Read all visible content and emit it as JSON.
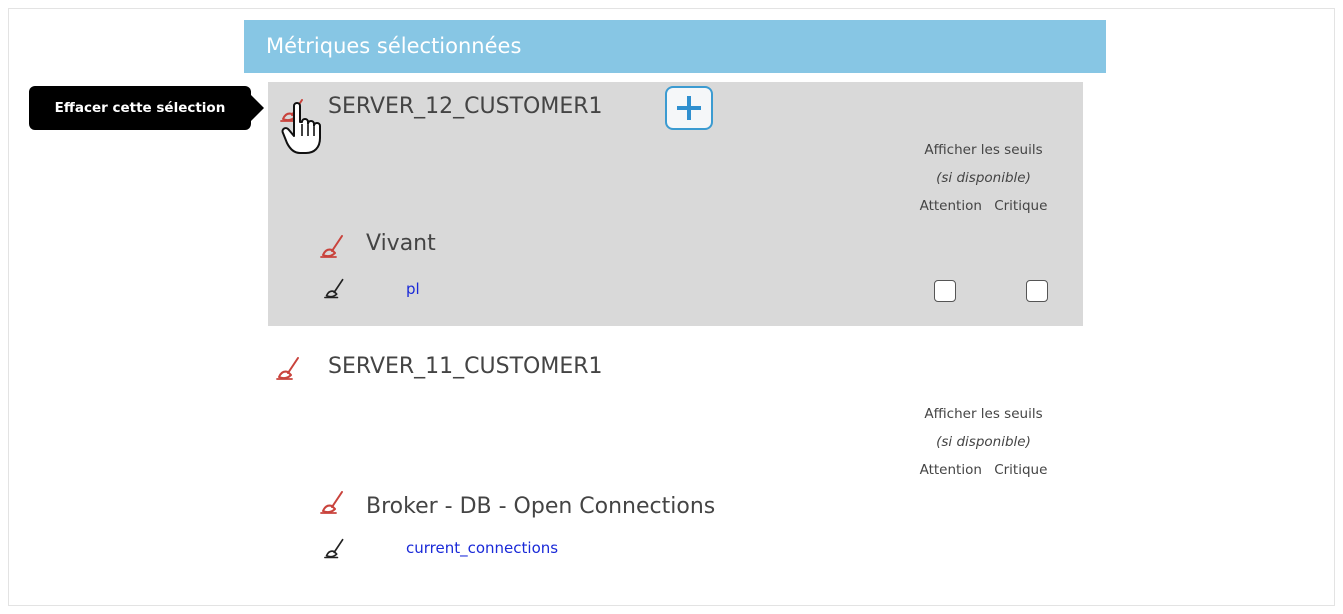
{
  "header": {
    "title": "Métriques sélectionnées"
  },
  "tooltip": {
    "text": "Effacer cette sélection"
  },
  "colors": {
    "header_bg": "#87c6e4",
    "active_block_bg": "#d9d9d9",
    "broom_red": "#c9433c",
    "broom_black": "#222222",
    "counter_link": "#1a2ad8",
    "add_button": "#2f8fcf"
  },
  "servers": [
    {
      "name": "SERVER_12_CUSTOMER1",
      "thresholds": {
        "title": "Afficher les seuils",
        "subtitle": "(si disponible)",
        "warning_label": "Attention",
        "critical_label": "Critique"
      },
      "metrics": [
        {
          "name": "Vivant",
          "counters": [
            {
              "name": "pl",
              "warning_checked": false,
              "critical_checked": false
            }
          ]
        }
      ]
    },
    {
      "name": "SERVER_11_CUSTOMER1",
      "thresholds": {
        "title": "Afficher les seuils",
        "subtitle": "(si disponible)",
        "warning_label": "Attention",
        "critical_label": "Critique"
      },
      "metrics": [
        {
          "name": "Broker - DB - Open Connections",
          "counters": [
            {
              "name": "current_connections"
            }
          ]
        }
      ]
    }
  ],
  "icons": {
    "clear_selection": "broom-icon",
    "add": "plus-icon",
    "cursor": "hand-pointer-icon"
  }
}
